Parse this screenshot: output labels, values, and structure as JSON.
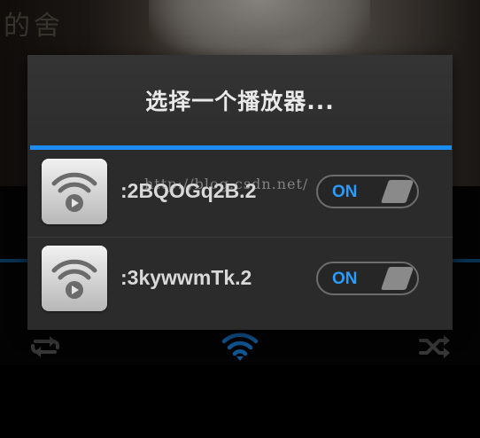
{
  "background": {
    "art_text": "的舍",
    "controls": [
      {
        "icon": "repeat-icon"
      },
      {
        "icon": "wifi-cast-icon",
        "color": "#1b8df0"
      },
      {
        "icon": "shuffle-icon"
      }
    ]
  },
  "dialog": {
    "title": "选择一个播放器...",
    "accent_color": "#1b8df0",
    "devices": [
      {
        "name": ":2BQOGq2B.2",
        "icon": "wifi-play-icon",
        "toggle": "ON"
      },
      {
        "name": ":3kywwmTk.2",
        "icon": "wifi-play-icon",
        "toggle": "ON"
      }
    ]
  },
  "watermark": "http://blog.csdn.net/"
}
